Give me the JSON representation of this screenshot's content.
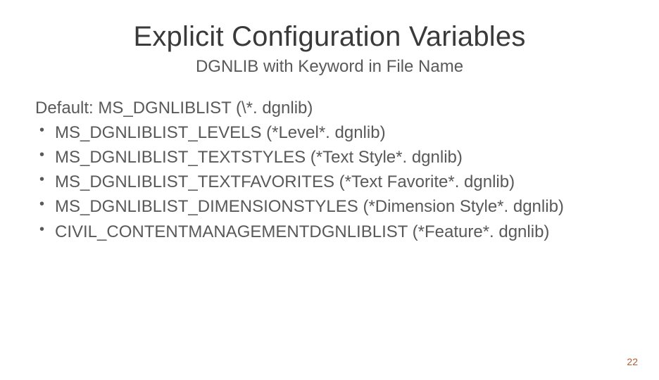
{
  "slide": {
    "title": "Explicit Configuration Variables",
    "subtitle": "DGNLIB with Keyword in File Name",
    "default_line": "Default: MS_DGNLIBLIST (\\*. dgnlib)",
    "bullets": [
      "MS_DGNLIBLIST_LEVELS (*Level*. dgnlib)",
      "MS_DGNLIBLIST_TEXTSTYLES (*Text Style*. dgnlib)",
      "MS_DGNLIBLIST_TEXTFAVORITES (*Text Favorite*. dgnlib)",
      "MS_DGNLIBLIST_DIMENSIONSTYLES (*Dimension Style*. dgnlib)",
      "CIVIL_CONTENTMANAGEMENTDGNLIBLIST (*Feature*. dgnlib)"
    ],
    "page_number": "22"
  }
}
